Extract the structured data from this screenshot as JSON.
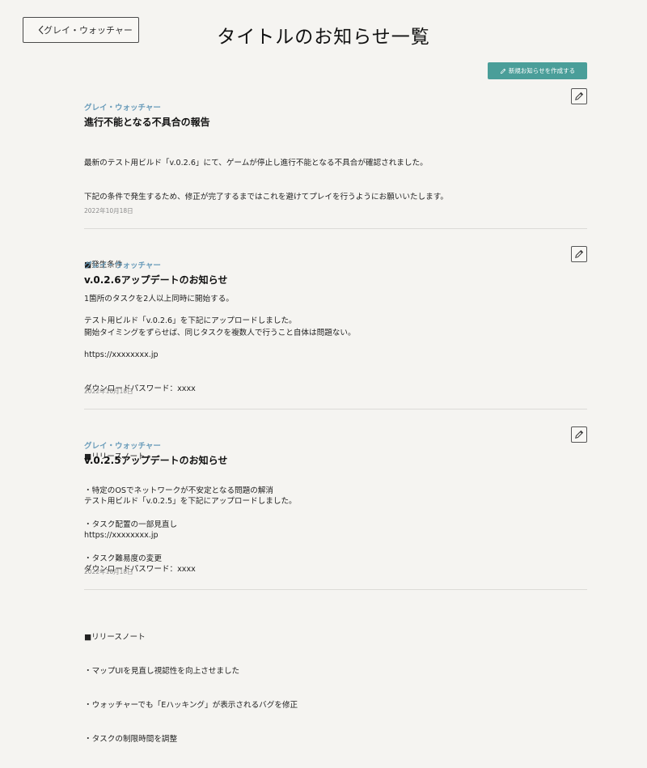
{
  "header": {
    "back_label": "グレイ・ウォッチャー",
    "title": "タイトルのお知らせ一覧",
    "create_label": "新規お知らせを作成する"
  },
  "posts": [
    {
      "author": "グレイ・ウォッチャー",
      "title": "進行不能となる不具合の報告",
      "lines": [
        "最新のテスト用ビルド「v.0.2.6」にて、ゲームが停止し進行不能となる不具合が確認されました。",
        "下記の条件で発生するため、修正が完了するまではこれを避けてプレイを行うようにお願いいたします。",
        "",
        "■発生条件",
        "1箇所のタスクを2人以上同時に開始する。",
        "開始タイミングをずらせば、同じタスクを複数人で行うこと自体は問題ない。"
      ],
      "date": "2022年10月18日"
    },
    {
      "author": "グレイ・ウォッチャー",
      "title": "v.0.2.6アップデートのお知らせ",
      "lines": [
        "テスト用ビルド「v.0.2.6」を下記にアップロードしました。",
        "https://xxxxxxxx.jp",
        "ダウンロードパスワード：xxxx",
        "",
        "■リリースノート",
        "・特定のOSでネットワークが不安定となる問題の解消",
        "・タスク配置の一部見直し",
        "・タスク難易度の変更"
      ],
      "date": "2022年10月18日"
    },
    {
      "author": "グレイ・ウォッチャー",
      "title": "v.0.2.5アップデートのお知らせ",
      "lines": [
        "テスト用ビルド「v.0.2.5」を下記にアップロードしました。",
        "https://xxxxxxxx.jp",
        "ダウンロードパスワード：xxxx",
        "",
        "■リリースノート",
        "・マップUIを見直し視認性を向上させました",
        "・ウォッチャーでも「Eハッキング」が表示されるバグを修正",
        "・タスクの制限時間を調整"
      ],
      "date": "2022年10月18日"
    }
  ]
}
